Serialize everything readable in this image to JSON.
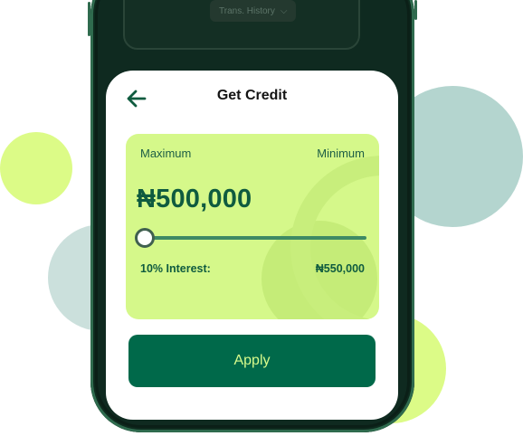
{
  "phone": {
    "history_label": "Trans. History"
  },
  "sheet": {
    "title": "Get Credit",
    "back_icon": "arrow-left-icon"
  },
  "credit": {
    "max_label": "Maximum",
    "min_label": "Minimum",
    "amount": "₦500,000",
    "slider_level": 0,
    "interest_label": "10% Interest:",
    "interest_value": "₦550,000"
  },
  "apply_label": "Apply",
  "colors": {
    "primary": "#00694a",
    "accent_lime": "#d5f88a",
    "button_text": "#d8fb8c"
  }
}
